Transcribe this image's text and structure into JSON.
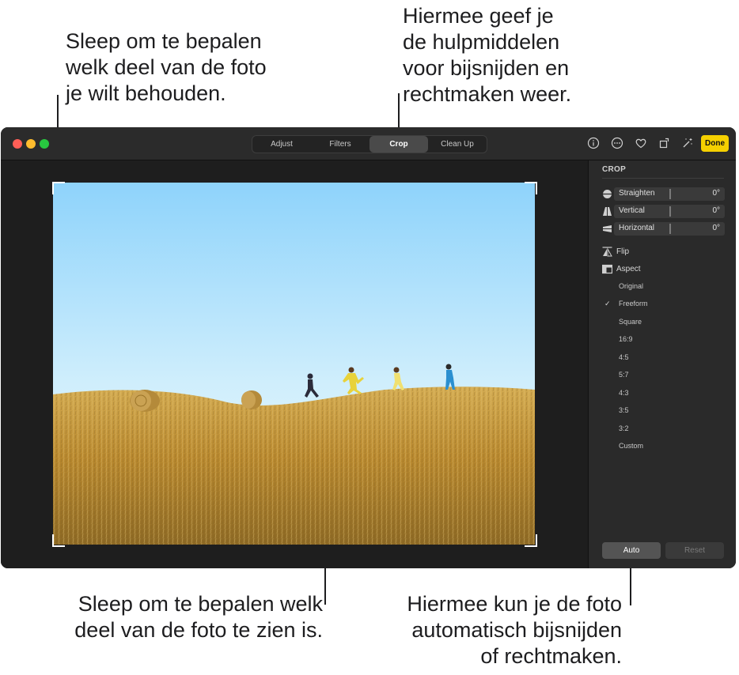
{
  "callouts": {
    "top_left": "Sleep om te bepalen\nwelk deel van de foto\nje wilt behouden.",
    "top_right": "Hiermee geef je\nde hulpmiddelen\nvoor bijsnijden en\nrechtmaken weer.",
    "bottom_left": "Sleep om te bepalen welk\ndeel van de foto te zien is.",
    "bottom_right": "Hiermee kun je de foto\nautomatisch bijsnijden\nof rechtmaken."
  },
  "toolbar": {
    "tabs": [
      "Adjust",
      "Filters",
      "Crop",
      "Clean Up"
    ],
    "active_tab": "Crop",
    "done_label": "Done",
    "icons": [
      "info-icon",
      "more-icon",
      "heart-icon",
      "rotate-icon",
      "magic-wand-icon"
    ]
  },
  "sidebar": {
    "title": "CROP",
    "sliders": [
      {
        "label": "Straighten",
        "value": "0°",
        "icon": "straighten-icon"
      },
      {
        "label": "Vertical",
        "value": "0°",
        "icon": "vertical-icon"
      },
      {
        "label": "Horizontal",
        "value": "0°",
        "icon": "horizontal-icon"
      }
    ],
    "flip_label": "Flip",
    "aspect_label": "Aspect",
    "aspect_options": [
      "Original",
      "Freeform",
      "Square",
      "16:9",
      "4:5",
      "5:7",
      "4:3",
      "3:5",
      "3:2",
      "Custom"
    ],
    "selected_aspect": "Freeform",
    "check_mark": "✓",
    "auto_label": "Auto",
    "reset_label": "Reset"
  },
  "colors": {
    "accent_done": "#f5d000",
    "close": "#ff5f57",
    "minimize": "#febc2e",
    "zoom": "#28c840"
  }
}
